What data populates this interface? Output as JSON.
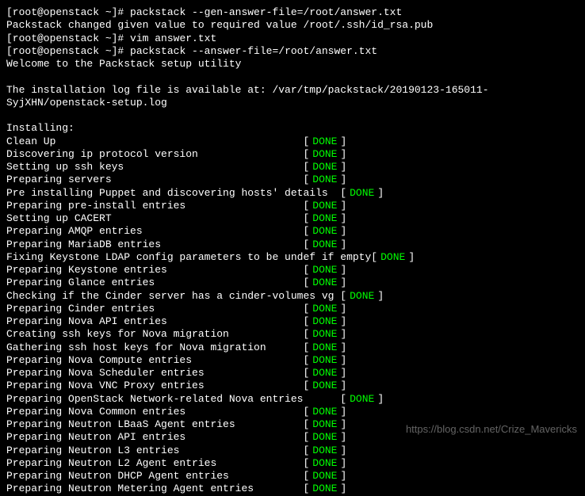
{
  "commands": [
    {
      "prompt": "[root@openstack ~]# ",
      "cmd": "packstack --gen-answer-file=/root/answer.txt"
    },
    {
      "output": "Packstack changed given value  to required value /root/.ssh/id_rsa.pub"
    },
    {
      "prompt": "[root@openstack ~]# ",
      "cmd": "vim answer.txt"
    },
    {
      "prompt": "[root@openstack ~]# ",
      "cmd": "packstack --answer-file=/root/answer.txt"
    },
    {
      "output": "Welcome to the Packstack setup utility"
    },
    {
      "output": ""
    },
    {
      "output": "The installation log file is available at: /var/tmp/packstack/20190123-165011-SyjXHN/openstack-setup.log"
    },
    {
      "output": ""
    },
    {
      "output": "Installing:"
    }
  ],
  "tasks": [
    {
      "name": "Clean Up",
      "pad": 48,
      "status": "DONE"
    },
    {
      "name": "Discovering ip protocol version",
      "pad": 48,
      "status": "DONE"
    },
    {
      "name": "Setting up ssh keys",
      "pad": 48,
      "status": "DONE"
    },
    {
      "name": "Preparing servers",
      "pad": 48,
      "status": "DONE"
    },
    {
      "name": "Pre installing Puppet and discovering hosts' details ",
      "pad": 54,
      "status": "DONE"
    },
    {
      "name": "Preparing pre-install entries",
      "pad": 48,
      "status": "DONE"
    },
    {
      "name": "Setting up CACERT",
      "pad": 48,
      "status": "DONE"
    },
    {
      "name": "Preparing AMQP entries",
      "pad": 48,
      "status": "DONE"
    },
    {
      "name": "Preparing MariaDB entries",
      "pad": 48,
      "status": "DONE"
    },
    {
      "name": "Fixing Keystone LDAP config parameters to be undef if empty",
      "pad": 59,
      "status": "DONE"
    },
    {
      "name": "Preparing Keystone entries",
      "pad": 48,
      "status": "DONE"
    },
    {
      "name": "Preparing Glance entries",
      "pad": 48,
      "status": "DONE"
    },
    {
      "name": "Checking if the Cinder server has a cinder-volumes vg",
      "pad": 54,
      "status": "DONE"
    },
    {
      "name": "Preparing Cinder entries",
      "pad": 48,
      "status": "DONE"
    },
    {
      "name": "Preparing Nova API entries",
      "pad": 48,
      "status": "DONE"
    },
    {
      "name": "Creating ssh keys for Nova migration",
      "pad": 48,
      "status": "DONE"
    },
    {
      "name": "Gathering ssh host keys for Nova migration",
      "pad": 48,
      "status": "DONE"
    },
    {
      "name": "Preparing Nova Compute entries",
      "pad": 48,
      "status": "DONE"
    },
    {
      "name": "Preparing Nova Scheduler entries",
      "pad": 48,
      "status": "DONE"
    },
    {
      "name": "Preparing Nova VNC Proxy entries",
      "pad": 48,
      "status": "DONE"
    },
    {
      "name": "Preparing OpenStack Network-related Nova entries",
      "pad": 54,
      "status": "DONE"
    },
    {
      "name": "Preparing Nova Common entries",
      "pad": 48,
      "status": "DONE"
    },
    {
      "name": "Preparing Neutron LBaaS Agent entries",
      "pad": 48,
      "status": "DONE"
    },
    {
      "name": "Preparing Neutron API entries",
      "pad": 48,
      "status": "DONE"
    },
    {
      "name": "Preparing Neutron L3 entries",
      "pad": 48,
      "status": "DONE"
    },
    {
      "name": "Preparing Neutron L2 Agent entries",
      "pad": 48,
      "status": "DONE"
    },
    {
      "name": "Preparing Neutron DHCP Agent entries",
      "pad": 48,
      "status": "DONE"
    },
    {
      "name": "Preparing Neutron Metering Agent entries",
      "pad": 48,
      "status": "DONE"
    }
  ],
  "bracket_open": "[",
  "bracket_close": "]",
  "watermark": "https://blog.csdn.net/Crize_Mavericks"
}
